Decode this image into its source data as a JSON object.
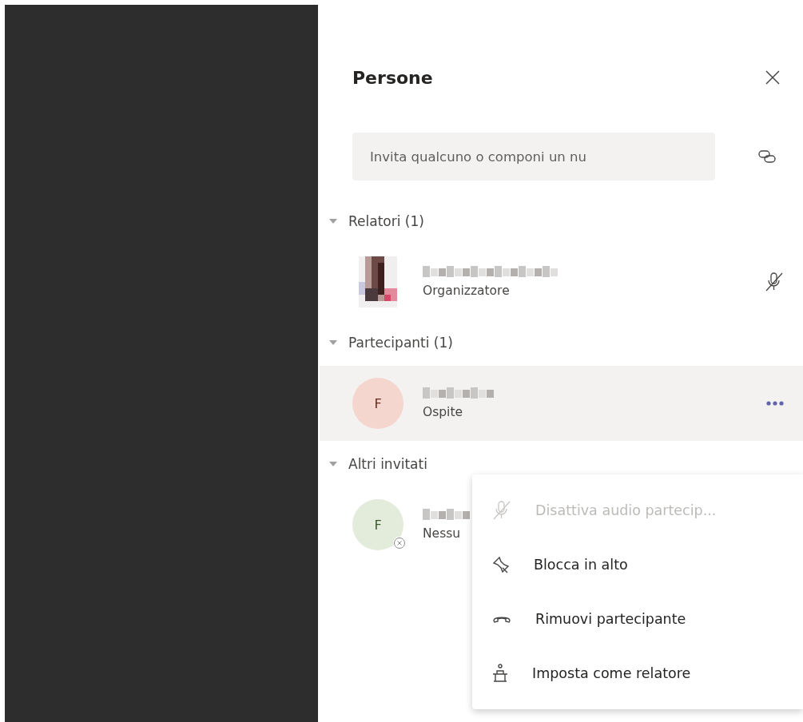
{
  "panel": {
    "title": "Persone"
  },
  "invite": {
    "placeholder": "Invita qualcuno o componi un nu"
  },
  "sections": [
    {
      "label": "Relatori (1)",
      "expanded": true,
      "people": [
        {
          "role": "Organizzatore",
          "selected": false,
          "action": {
            "kind": "mute"
          },
          "invite_declined": false
        }
      ]
    },
    {
      "label": "Partecipanti (1)",
      "expanded": true,
      "people": [
        {
          "kind": "initial",
          "initial": "F",
          "color": "#f4d6cf",
          "role": "Ospite",
          "selected": true,
          "action": {
            "kind": "more"
          },
          "invite_declined": false
        }
      ]
    },
    {
      "label": "Altri invitati",
      "expanded": true,
      "people": [
        {
          "kind": "initial",
          "initial": "F",
          "color": "#e3ebdb",
          "role": "Nessu",
          "selected": false,
          "invite_declined": true
        }
      ]
    }
  ],
  "menu": {
    "items": [
      {
        "kind": "mute",
        "label": "Disattiva audio partecip...",
        "disabled": true
      },
      {
        "kind": "pin",
        "label": "Blocca in alto",
        "disabled": false
      },
      {
        "kind": "remove",
        "label": "Rimuovi partecipante",
        "disabled": false
      },
      {
        "kind": "presenter",
        "label": "Imposta come relatore",
        "disabled": false
      }
    ]
  }
}
